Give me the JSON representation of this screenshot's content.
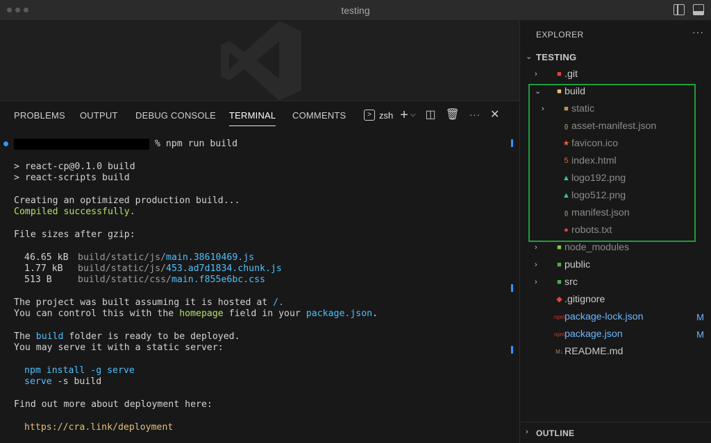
{
  "window": {
    "title": "testing"
  },
  "panel": {
    "tabs": [
      {
        "label": "PROBLEMS"
      },
      {
        "label": "OUTPUT"
      },
      {
        "label": "DEBUG CONSOLE"
      },
      {
        "label": "TERMINAL"
      },
      {
        "label": "COMMENTS"
      }
    ],
    "active_tab": "TERMINAL",
    "shell_label": "zsh"
  },
  "terminal": {
    "prompt_suffix": " % npm run build",
    "lines": [
      "> react-cp@0.1.0 build",
      "> react-scripts build",
      "Creating an optimized production build...",
      "Compiled successfully.",
      "File sizes after gzip:"
    ],
    "files": [
      {
        "size": "46.65 kB",
        "dir": "build/static/js/",
        "name": "main.38610469.js"
      },
      {
        "size": "1.77 kB",
        "dir": "build/static/js/",
        "name": "453.ad7d1834.chunk.js"
      },
      {
        "size": "513 B",
        "dir": "build/static/css/",
        "name": "main.f855e6bc.css"
      }
    ],
    "hosted": {
      "prefix": "The project was built assuming it is hosted at ",
      "path": "/.",
      "ctrl_prefix": "You can control this with the ",
      "homepage": "homepage",
      "ctrl_mid": " field in your ",
      "pkg": "package.json",
      "ctrl_end": "."
    },
    "ready": {
      "prefix": "The ",
      "build": "build",
      "suffix": " folder is ready to be deployed.",
      "serve_line": "You may serve it with a static server:"
    },
    "cmd1": "npm install -g serve",
    "cmd2_cmd": "serve",
    "cmd2_args": " -s build",
    "more": "Find out more about deployment here:",
    "link": "https://cra.link/deployment"
  },
  "explorer": {
    "title": "EXPLORER",
    "more": "···",
    "root": "TESTING",
    "outline": "OUTLINE"
  },
  "tree": [
    {
      "name": ".git",
      "icon": "git-folder-icon",
      "color": "#e0443b"
    },
    {
      "name": "build",
      "icon": "folder-open-icon",
      "color": "#e8c36b"
    },
    {
      "name": "static",
      "icon": "folder-icon",
      "color": "#c09553"
    },
    {
      "name": "asset-manifest.json",
      "icon": "json-icon",
      "color": "#e5c07b"
    },
    {
      "name": "favicon.ico",
      "icon": "favicon-icon",
      "color": "#f25b3a"
    },
    {
      "name": "index.html",
      "icon": "html-icon",
      "color": "#e4603a"
    },
    {
      "name": "logo192.png",
      "icon": "image-icon",
      "color": "#3ec5a0"
    },
    {
      "name": "logo512.png",
      "icon": "image-icon",
      "color": "#3ec5a0"
    },
    {
      "name": "manifest.json",
      "icon": "json-icon",
      "color": "#e5c07b"
    },
    {
      "name": "robots.txt",
      "icon": "robot-icon",
      "color": "#e0443b"
    },
    {
      "name": "node_modules",
      "icon": "node-folder-icon",
      "color": "#8bc34a"
    },
    {
      "name": "public",
      "icon": "public-folder-icon",
      "color": "#4caf50"
    },
    {
      "name": "src",
      "icon": "src-folder-icon",
      "color": "#4caf50"
    },
    {
      "name": ".gitignore",
      "icon": "git-icon",
      "color": "#e0443b"
    },
    {
      "name": "package-lock.json",
      "icon": "npm-icon",
      "color": "#cb3837",
      "badge": "M"
    },
    {
      "name": "package.json",
      "icon": "npm-icon",
      "color": "#cb3837",
      "badge": "M"
    },
    {
      "name": "README.md",
      "icon": "markdown-icon",
      "color": "#a08a5a"
    }
  ]
}
